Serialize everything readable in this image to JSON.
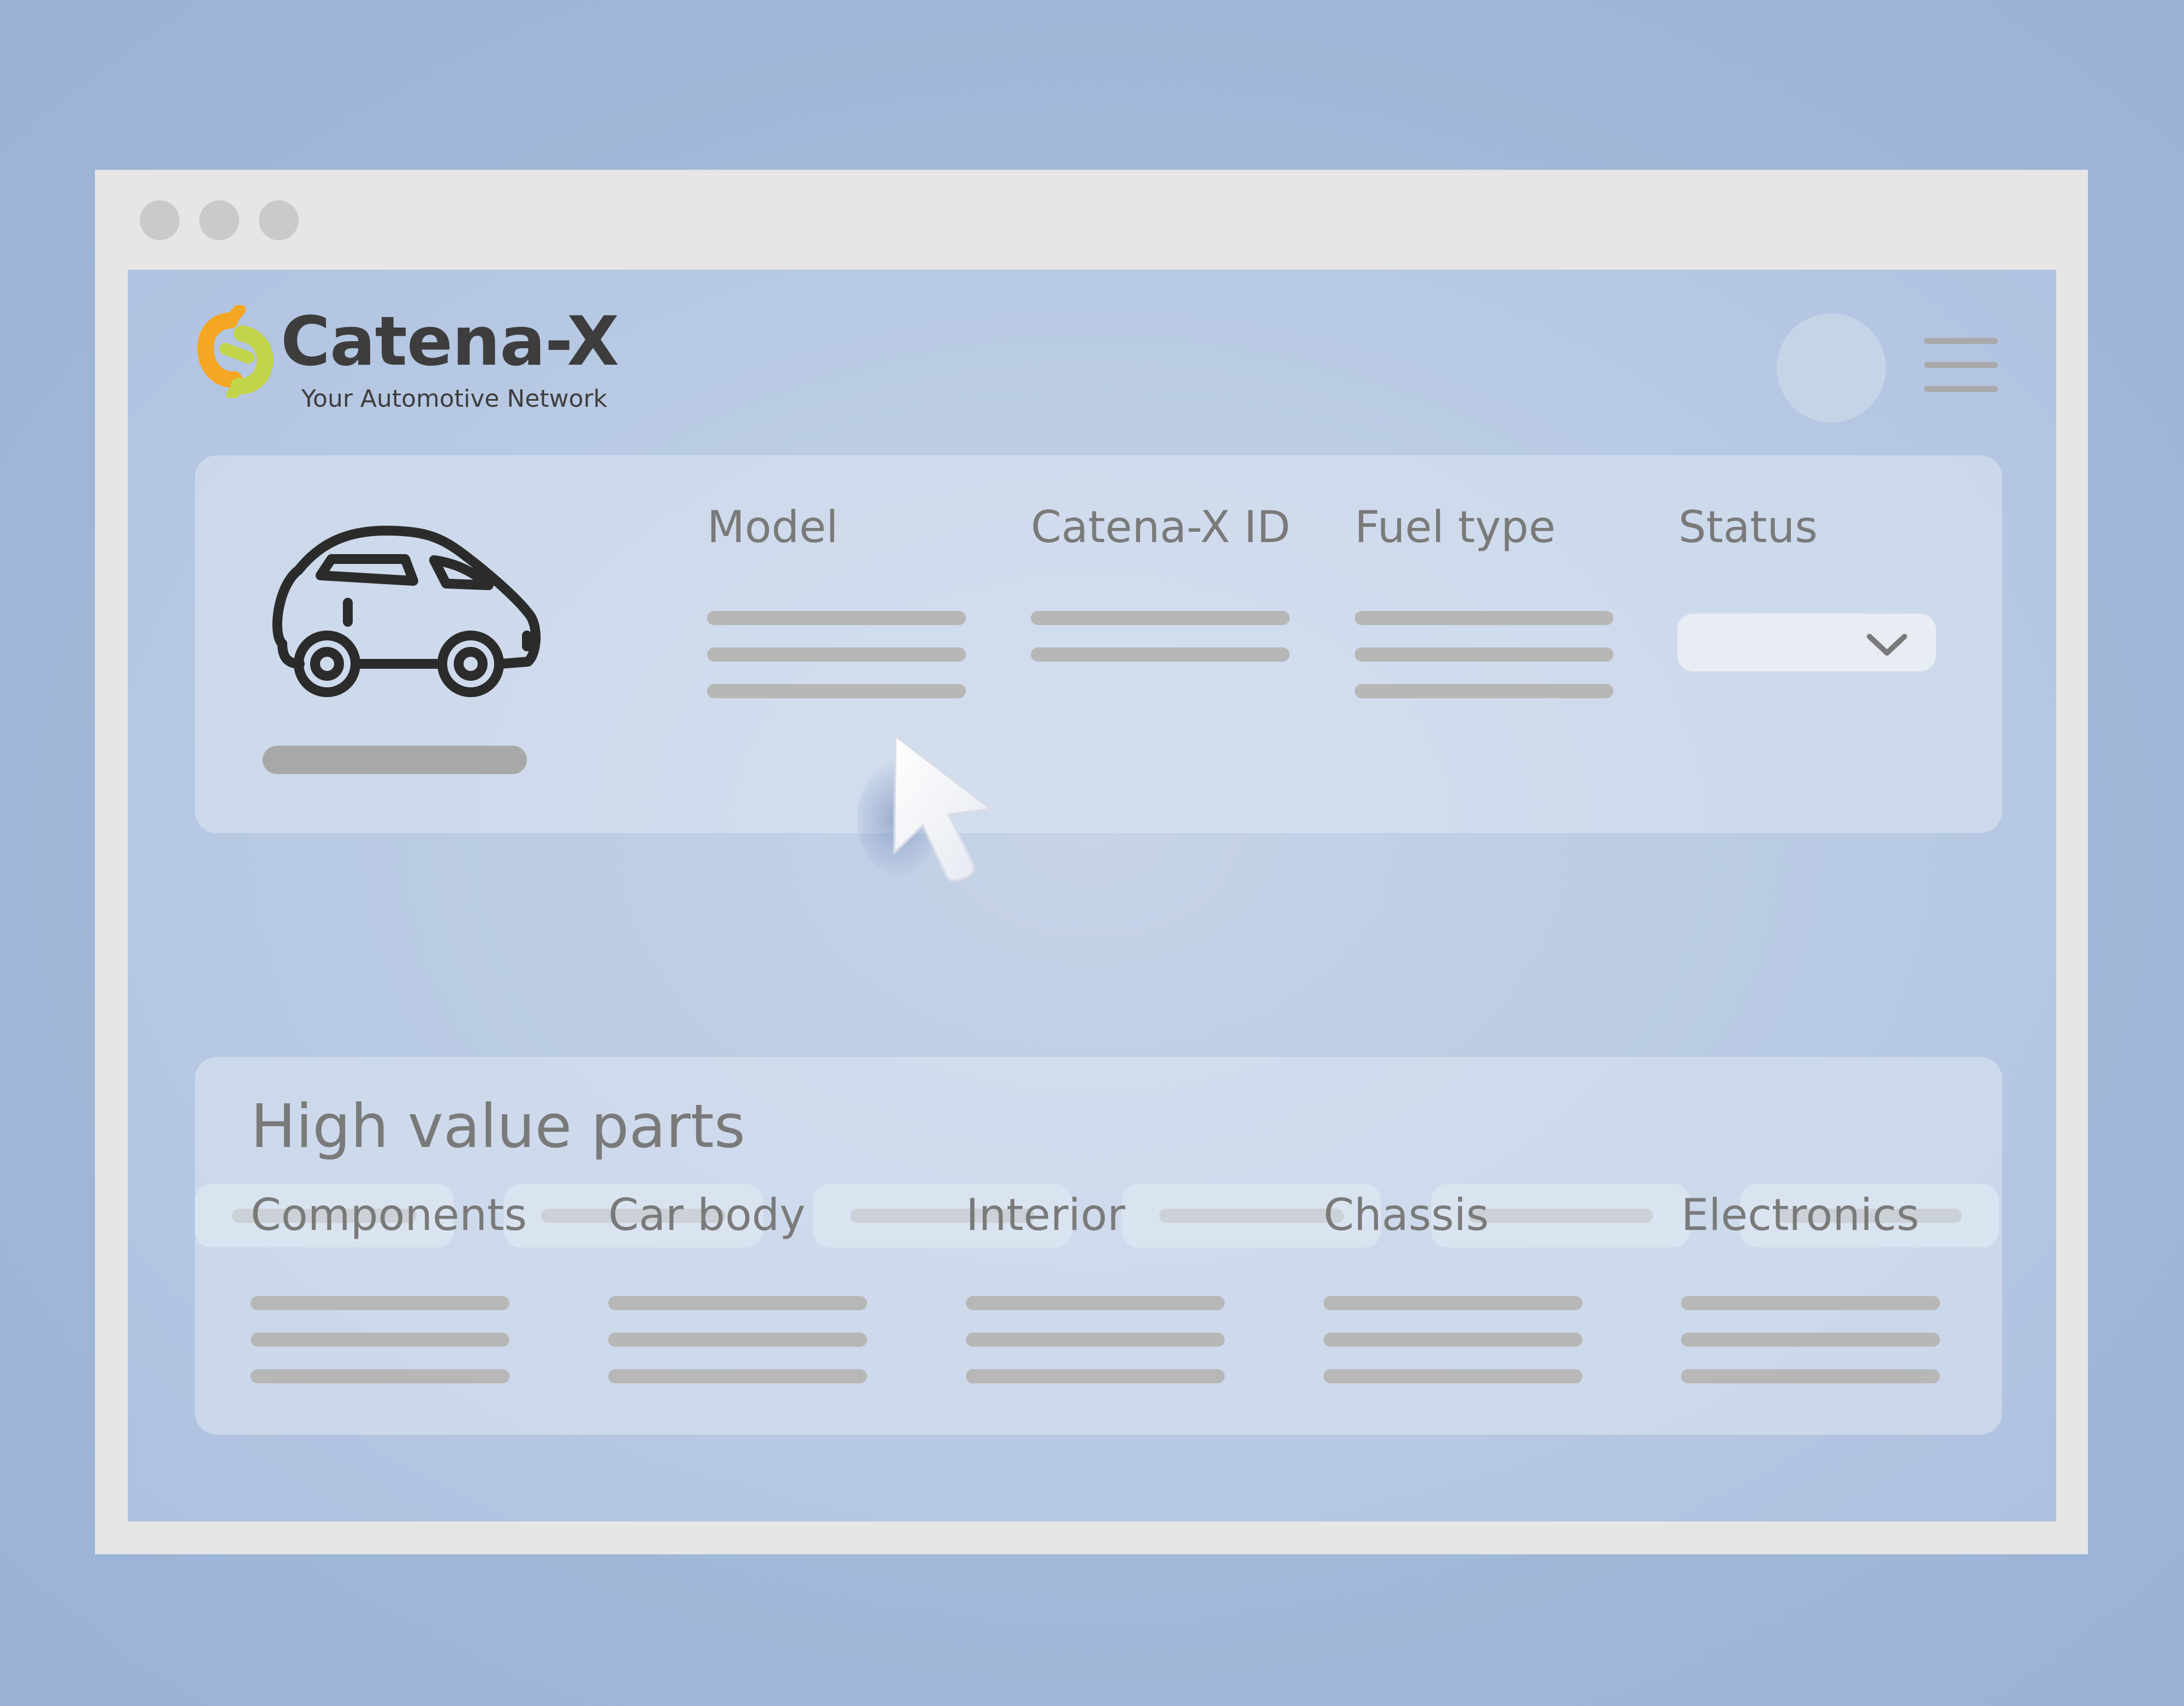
{
  "window": {
    "controls": [
      "close",
      "minimize",
      "maximize"
    ]
  },
  "brand": {
    "name": "Catena-X",
    "tagline": "Your Automotive Network",
    "colors": {
      "orange": "#f5a623",
      "green": "#c2d54a",
      "text": "#3d3d3d"
    }
  },
  "header": {
    "avatar_icon": "user-avatar",
    "menu_icon": "hamburger-menu-icon"
  },
  "vehicle": {
    "icon": "car-icon",
    "columns": [
      {
        "label": "Model"
      },
      {
        "label": "Catena-X ID"
      },
      {
        "label": "Fuel type"
      },
      {
        "label": "Status"
      }
    ],
    "status_select": {
      "value": "",
      "icon": "chevron-down-icon"
    }
  },
  "tabs": {
    "count": 6
  },
  "parts": {
    "title": "High value parts",
    "columns": [
      {
        "label": "Components"
      },
      {
        "label": "Car body"
      },
      {
        "label": "Interior"
      },
      {
        "label": "Chassis"
      },
      {
        "label": "Electronics"
      }
    ]
  },
  "colors": {
    "background": "#a1b8d9",
    "window_frame": "#e6e6e6",
    "placeholder_line": "#b7b7b7",
    "label_text": "#7a7a7a"
  }
}
